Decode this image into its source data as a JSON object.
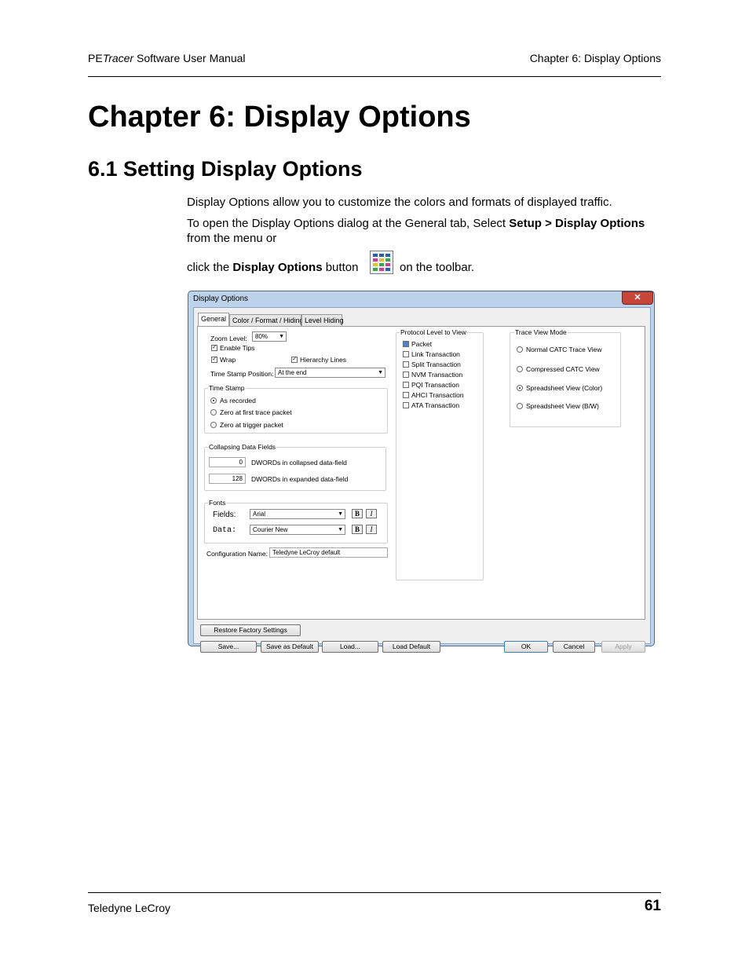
{
  "header": {
    "manual_prefix": "PE",
    "manual_italic": "Tracer",
    "manual_suffix": " Software User Manual",
    "chapter": "Chapter 6: Display Options"
  },
  "chapter_title": "Chapter 6:  Display Options",
  "section_title": "6.1 Setting Display Options",
  "para1": "Display Options allow you to customize the colors and formats of displayed traffic.",
  "para2": {
    "pre": "To open the Display Options dialog at the General tab, Select ",
    "bold": "Setup > Display Options",
    "post": " from the menu or"
  },
  "para3": {
    "pre": "click the ",
    "bold": "Display Options",
    "mid": " button",
    "post": "on the toolbar."
  },
  "toolbar_icon": "display-options-icon",
  "dialog": {
    "title": "Display Options",
    "close": "✕",
    "tabs": [
      "General",
      "Color / Format / Hiding",
      "Level Hiding"
    ],
    "zoom_label": "Zoom Level:",
    "zoom_value": "80%",
    "enable_tips": "Enable Tips",
    "wrap": "Wrap",
    "hierarchy_lines": "Hierarchy Lines",
    "timestamp_position_label": "Time Stamp Position:",
    "timestamp_position_value": "At the end",
    "timestamp_group": "Time Stamp",
    "timestamp_options": [
      "As recorded",
      "Zero at first trace packet",
      "Zero at trigger packet"
    ],
    "collapsing_group": "Collapsing Data Fields",
    "collapsed_value": "0",
    "collapsed_label": "DWORDs in collapsed data-field",
    "expanded_value": "128",
    "expanded_label": "DWORDs in expanded data-field",
    "fonts_group": "Fonts",
    "fields_label": "Fields:",
    "fields_font": "Arial",
    "data_label": "Data:",
    "data_font": "Courier New",
    "bold_btn": "B",
    "italic_btn": "I",
    "config_label": "Configuration Name:",
    "config_value": "Teledyne LeCroy default",
    "protocol_group": "Protocol Level to View",
    "protocol_levels": [
      "Packet",
      "Link Transaction",
      "Split Transaction",
      "NVM Transaction",
      "PQI Transaction",
      "AHCI Transaction",
      "ATA Transaction"
    ],
    "trace_group": "Trace View Mode",
    "trace_modes": [
      "Normal CATC Trace View",
      "Compressed CATC View",
      "Spreadsheet View (Color)",
      "Spreadsheet View (B/W)"
    ],
    "buttons": {
      "restore": "Restore Factory Settings",
      "save": "Save...",
      "save_default": "Save as Default",
      "load": "Load...",
      "load_default": "Load Default",
      "ok": "OK",
      "cancel": "Cancel",
      "apply": "Apply"
    }
  },
  "footer": {
    "company": "Teledyne LeCroy",
    "page": "61"
  }
}
